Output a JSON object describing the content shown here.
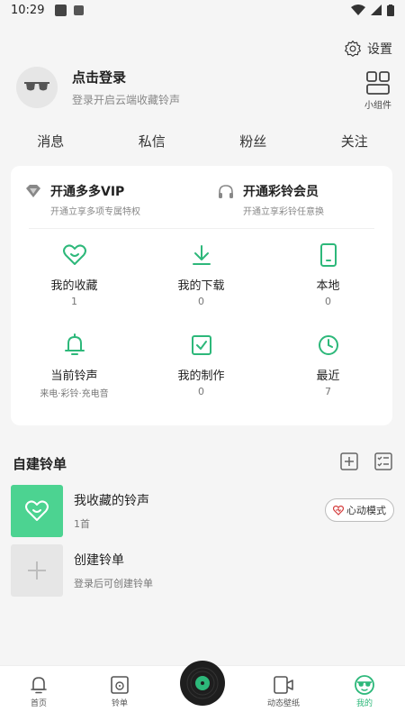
{
  "status_bar": {
    "time": "10:29"
  },
  "header": {
    "settings_label": "设置",
    "widget_label": "小组件"
  },
  "profile": {
    "name": "点击登录",
    "subtitle": "登录开启云端收藏铃声"
  },
  "social": [
    "消息",
    "私信",
    "粉丝",
    "关注"
  ],
  "vip": [
    {
      "title": "开通多多VIP",
      "subtitle": "开通立享多项专属特权",
      "icon": "diamond-icon"
    },
    {
      "title": "开通彩铃会员",
      "subtitle": "开通立享彩铃任意换",
      "icon": "headset-icon"
    }
  ],
  "grid": [
    {
      "label": "我的收藏",
      "count": "1",
      "icon": "heart-icon"
    },
    {
      "label": "我的下载",
      "count": "0",
      "icon": "download-icon"
    },
    {
      "label": "本地",
      "count": "0",
      "icon": "phone-icon"
    },
    {
      "label": "当前铃声",
      "count": "来电·彩铃·充电音",
      "icon": "bell-icon"
    },
    {
      "label": "我的制作",
      "count": "0",
      "icon": "check-square-icon"
    },
    {
      "label": "最近",
      "count": "7",
      "icon": "clock-icon"
    }
  ],
  "section": {
    "title": "自建铃单"
  },
  "playlists": [
    {
      "title": "我收藏的铃声",
      "subtitle": "1首",
      "button": "心动模式"
    },
    {
      "title": "创建铃单",
      "subtitle": "登录后可创建铃单"
    }
  ],
  "tabs": [
    "首页",
    "铃单",
    "动态壁纸",
    "我的"
  ],
  "colors": {
    "accent": "#2db87a",
    "card_green": "#4cd391"
  }
}
